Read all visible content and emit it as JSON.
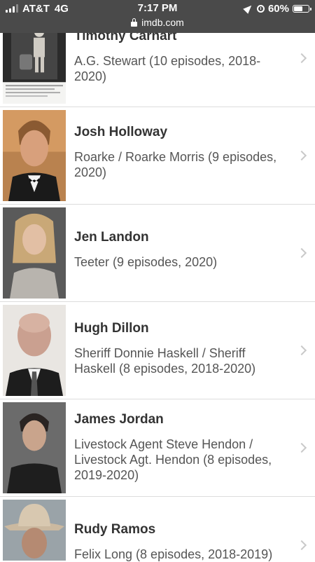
{
  "status_bar": {
    "carrier": "AT&T",
    "network": "4G",
    "time": "7:17 PM",
    "battery": "60%",
    "battery_level": 0.6,
    "url": "imdb.com"
  },
  "cast": [
    {
      "name": "Timothy Carhart",
      "role": "A.G. Stewart (10 episodes, 2018-2020)"
    },
    {
      "name": "Josh Holloway",
      "role": "Roarke / Roarke Morris (9 episodes, 2020)"
    },
    {
      "name": "Jen Landon",
      "role": "Teeter (9 episodes, 2020)"
    },
    {
      "name": "Hugh Dillon",
      "role": "Sheriff Donnie Haskell / Sheriff Haskell (8 episodes, 2018-2020)"
    },
    {
      "name": "James Jordan",
      "role": "Livestock Agent Steve Hendon / Livestock Agt. Hendon (8 episodes, 2019-2020)"
    },
    {
      "name": "Rudy Ramos",
      "role": "Felix Long (8 episodes, 2018-2019)"
    }
  ],
  "icons": {
    "row_chevron": "chevron-right-icon",
    "url_lock": "lock-icon"
  }
}
